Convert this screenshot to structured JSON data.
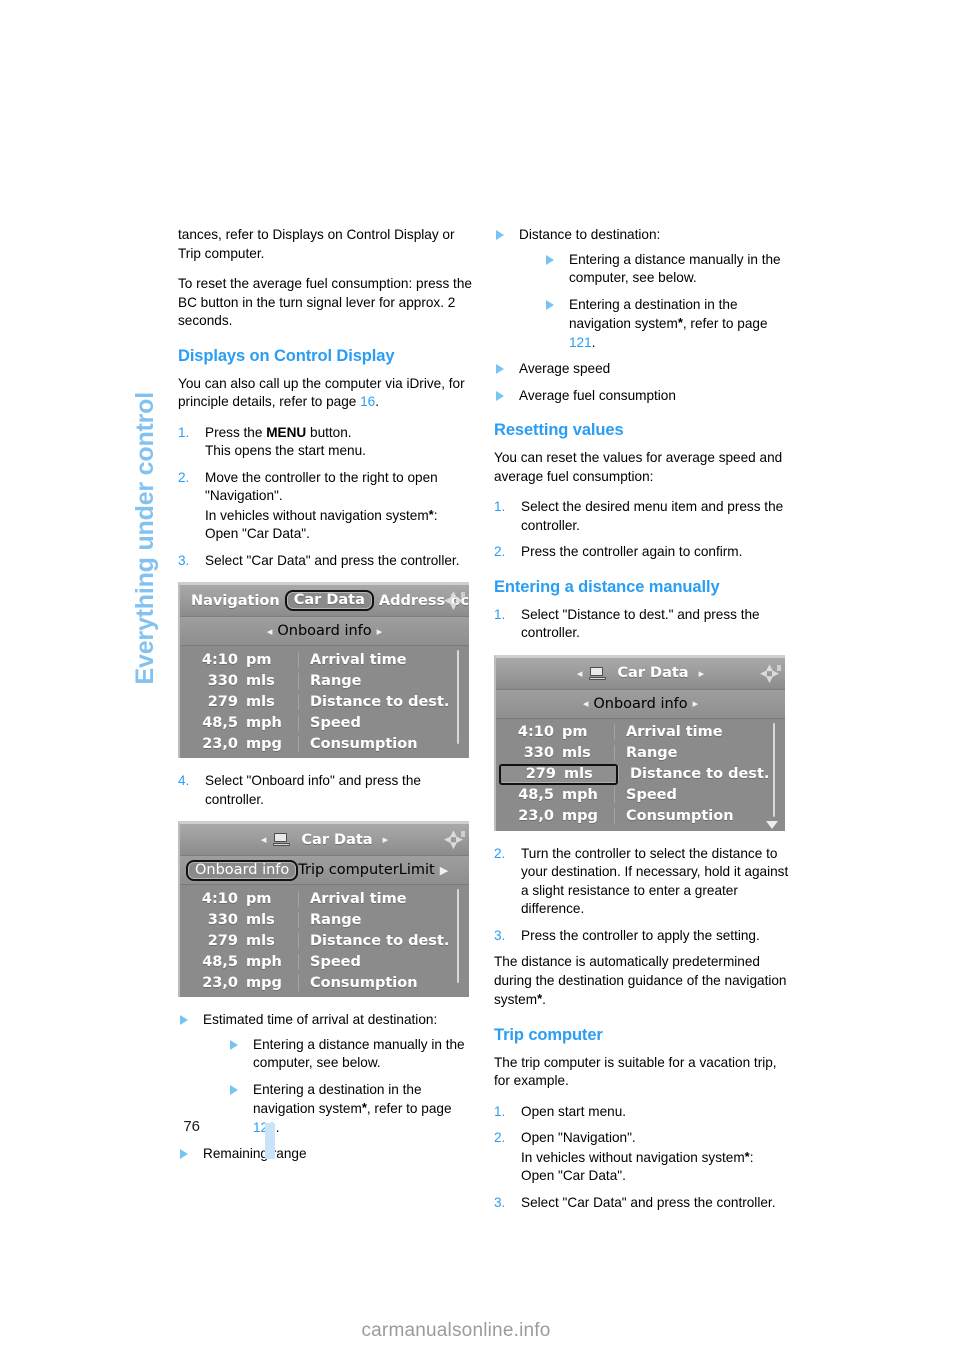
{
  "chapter_tab": {
    "label": "Everything under control"
  },
  "page_number": "76",
  "watermark": "carmanualsonline.info",
  "left_column": {
    "para_1": "tances, refer to Displays on Control Display or Trip computer.",
    "para_2": "To reset the average fuel consumption: press the BC button in the turn signal lever for approx. 2 seconds.",
    "heading_displays": "Displays on Control Display",
    "para_3_a": "You can also call up the computer via iDrive, for principle details, refer to page ",
    "para_3_link": "16",
    "para_3_b": ".",
    "step_1_num": "1.",
    "step_1_a": "Press the ",
    "step_1_bold": "MENU",
    "step_1_b": " button.",
    "step_1_line2": "This opens the start menu.",
    "step_2_num": "2.",
    "step_2_line1": "Move the controller to the right to open \"Navigation\".",
    "step_2_line2_a": "In vehicles without navigation system",
    "step_2_line2_ast": "*",
    "step_2_line2_b": ":",
    "step_2_line3": "Open \"Car Data\".",
    "step_3_num": "3.",
    "step_3_text": "Select \"Car Data\" and press the controller.",
    "step_4_num": "4.",
    "step_4_text": "Select \"Onboard info\" and press the controller.",
    "bullets": {
      "b1": "Estimated time of arrival at destination:",
      "b1_sub1": "Entering a distance manually in the computer, see below.",
      "b1_sub2_a": "Entering a destination in the navigation system",
      "b1_sub2_ast": "*",
      "b1_sub2_b": ", refer to page ",
      "b1_sub2_link": "121",
      "b1_sub2_c": ".",
      "b2": "Remaining range"
    }
  },
  "right_column": {
    "bullets": {
      "b1": "Distance to destination:",
      "b1_sub1": "Entering a distance manually in the computer, see below.",
      "b1_sub2_a": "Entering a destination in the navigation system",
      "b1_sub2_ast": "*",
      "b1_sub2_b": ", refer to page ",
      "b1_sub2_link": "121",
      "b1_sub2_c": ".",
      "b2": "Average speed",
      "b3": "Average fuel consumption"
    },
    "heading_resetting": "Resetting values",
    "para_reset": "You can reset the values for average speed and average fuel consumption:",
    "reset_step_1_num": "1.",
    "reset_step_1": "Select the desired menu item and press the controller.",
    "reset_step_2_num": "2.",
    "reset_step_2": "Press the controller again to confirm.",
    "heading_entering": "Entering a distance manually",
    "enter_step_1_num": "1.",
    "enter_step_1": "Select \"Distance to dest.\" and press the controller.",
    "enter_step_2_num": "2.",
    "enter_step_2": "Turn the controller to select the distance to your destination. If necessary, hold it against a slight resistance to enter a greater difference.",
    "enter_step_3_num": "3.",
    "enter_step_3": "Press the controller to apply the setting.",
    "para_auto_a": "The distance is automatically predetermined during the destination guidance of the navigation system",
    "para_auto_ast": "*",
    "para_auto_b": ".",
    "heading_trip": "Trip computer",
    "para_trip": "The trip computer is suitable for a vacation trip, for example.",
    "trip_step_1_num": "1.",
    "trip_step_1": "Open start menu.",
    "trip_step_2_num": "2.",
    "trip_step_2_line1": "Open \"Navigation\".",
    "trip_step_2_line2_a": "In vehicles without navigation system",
    "trip_step_2_line2_ast": "*",
    "trip_step_2_line2_b": ":",
    "trip_step_2_line3": "Open \"Car Data\".",
    "trip_step_3_num": "3.",
    "trip_step_3": "Select \"Car Data\" and press the controller."
  },
  "screens": {
    "screen_1": {
      "topbar": {
        "item_left": "Navigation",
        "item_selected": "Car Data",
        "item_right": "Address bc"
      },
      "subbar": {
        "arrow_left": "◂",
        "title": "Onboard info",
        "arrow_right": "▸"
      },
      "rows": [
        {
          "value": "4:10",
          "unit": "pm",
          "label": "Arrival time",
          "selected": false
        },
        {
          "value": "330",
          "unit": "mls",
          "label": "Range",
          "selected": false
        },
        {
          "value": "279",
          "unit": "mls",
          "label": "Distance to dest.",
          "selected": false
        },
        {
          "value": "48,5",
          "unit": "mph",
          "label": "Speed",
          "selected": false
        },
        {
          "value": "23,0",
          "unit": "mpg",
          "label": "Consumption",
          "selected": false
        }
      ]
    },
    "screen_2": {
      "topbar": {
        "arrow_left": "◂",
        "title": "Car Data",
        "arrow_right": "▸"
      },
      "subbar": {
        "item_selected": "Onboard info",
        "item_2": "Trip computer",
        "item_3": "Limit"
      },
      "rows": [
        {
          "value": "4:10",
          "unit": "pm",
          "label": "Arrival time",
          "selected": false
        },
        {
          "value": "330",
          "unit": "mls",
          "label": "Range",
          "selected": false
        },
        {
          "value": "279",
          "unit": "mls",
          "label": "Distance to dest.",
          "selected": false
        },
        {
          "value": "48,5",
          "unit": "mph",
          "label": "Speed",
          "selected": false
        },
        {
          "value": "23,0",
          "unit": "mpg",
          "label": "Consumption",
          "selected": false
        }
      ]
    },
    "screen_3": {
      "topbar": {
        "arrow_left": "◂",
        "title": "Car Data",
        "arrow_right": "▸"
      },
      "subbar": {
        "arrow_left": "◂",
        "title": "Onboard info",
        "arrow_right": "▸"
      },
      "rows": [
        {
          "value": "4:10",
          "unit": "pm",
          "label": "Arrival time",
          "selected": false
        },
        {
          "value": "330",
          "unit": "mls",
          "label": "Range",
          "selected": false
        },
        {
          "value": "279",
          "unit": "mls",
          "label": "Distance to dest.",
          "selected": true
        },
        {
          "value": "48,5",
          "unit": "mph",
          "label": "Speed",
          "selected": false
        },
        {
          "value": "23,0",
          "unit": "mpg",
          "label": "Consumption",
          "selected": false
        }
      ]
    }
  },
  "colors": {
    "accent_blue": "#2a9df4",
    "tab_blue": "#83c2f0",
    "bullet_blue": "#79c3f2",
    "page_bar": "#c9e3f8",
    "screen_gray": "#8b8b8b"
  }
}
